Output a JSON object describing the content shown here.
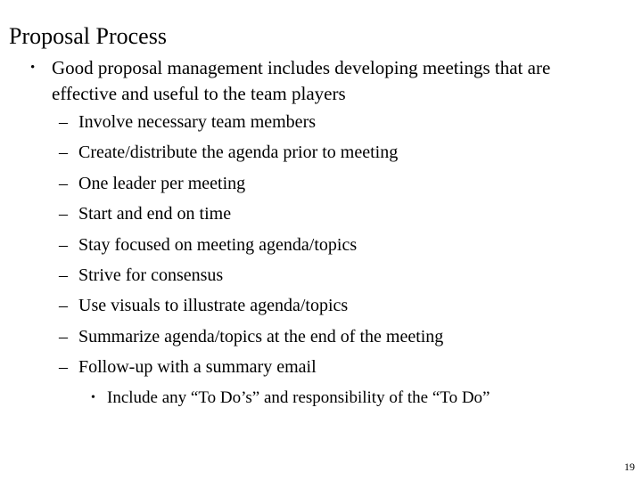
{
  "slide": {
    "title": "Proposal Process",
    "page_number": "19",
    "bullets": [
      {
        "level": 1,
        "marker": "•",
        "text": "Good proposal management includes developing meetings that are effective and useful to the team players"
      },
      {
        "level": 2,
        "marker": "–",
        "text": "Involve necessary team members"
      },
      {
        "level": 2,
        "marker": "–",
        "text": "Create/distribute the agenda prior to meeting"
      },
      {
        "level": 2,
        "marker": "–",
        "text": "One leader per meeting"
      },
      {
        "level": 2,
        "marker": "–",
        "text": "Start and end on time"
      },
      {
        "level": 2,
        "marker": "–",
        "text": "Stay focused on meeting agenda/topics"
      },
      {
        "level": 2,
        "marker": "–",
        "text": "Strive for consensus"
      },
      {
        "level": 2,
        "marker": "–",
        "text": "Use visuals to illustrate agenda/topics"
      },
      {
        "level": 2,
        "marker": "–",
        "text": "Summarize agenda/topics at the end of the meeting"
      },
      {
        "level": 2,
        "marker": "–",
        "text": "Follow-up with a summary email"
      },
      {
        "level": 3,
        "marker": "•",
        "text": "Include any “To Do’s” and responsibility of the “To Do”"
      }
    ]
  }
}
